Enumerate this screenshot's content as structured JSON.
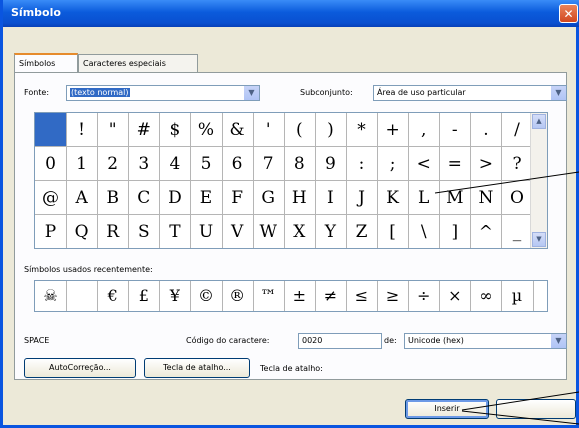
{
  "window": {
    "title": "Símbolo",
    "close_glyph": "✕"
  },
  "tabs": [
    {
      "label": "Símbolos"
    },
    {
      "label": "Caracteres especiais"
    }
  ],
  "font": {
    "label": "Fonte:",
    "value": "(texto normal)"
  },
  "subset": {
    "label": "Subconjunto:",
    "value": "Área de uso particular"
  },
  "symbol_grid": {
    "rows": [
      [
        "",
        "!",
        "\"",
        "#",
        "$",
        "%",
        "&",
        "'",
        "(",
        ")",
        "*",
        "+",
        ",",
        "-",
        ".",
        "/"
      ],
      [
        "0",
        "1",
        "2",
        "3",
        "4",
        "5",
        "6",
        "7",
        "8",
        "9",
        ":",
        ";",
        "<",
        "=",
        ">",
        "?"
      ],
      [
        "@",
        "A",
        "B",
        "C",
        "D",
        "E",
        "F",
        "G",
        "H",
        "I",
        "J",
        "K",
        "L",
        "M",
        "N",
        "O"
      ],
      [
        "P",
        "Q",
        "R",
        "S",
        "T",
        "U",
        "V",
        "W",
        "X",
        "Y",
        "Z",
        "[",
        "\\",
        "]",
        "^",
        "_"
      ]
    ],
    "selected": "SPACE"
  },
  "recent": {
    "label": "Símbolos usados recentemente:",
    "symbols": [
      "☠",
      "",
      "€",
      "£",
      "¥",
      "©",
      "®",
      "™",
      "±",
      "≠",
      "≤",
      "≥",
      "÷",
      "×",
      "∞",
      "µ"
    ]
  },
  "char_name": "SPACE",
  "char_code": {
    "label": "Código do caractere:",
    "value": "0020"
  },
  "from": {
    "label": "de:",
    "value": "Unicode (hex)"
  },
  "buttons": {
    "autocorrect": "AutoCorreção...",
    "shortcut_key": "Tecla de atalho...",
    "shortcut_text": "Tecla de atalho:",
    "insert": "Inserir"
  },
  "colors": {
    "title_bar": "#0b5bdc",
    "selection": "#316ac5",
    "dialog_bg": "#ece9d8",
    "close_button": "#d2471f"
  },
  "icons": {
    "close": "close-icon",
    "dropdown": "chevron-down-icon",
    "scroll_up": "arrow-up-icon",
    "scroll_down": "arrow-down-icon"
  }
}
